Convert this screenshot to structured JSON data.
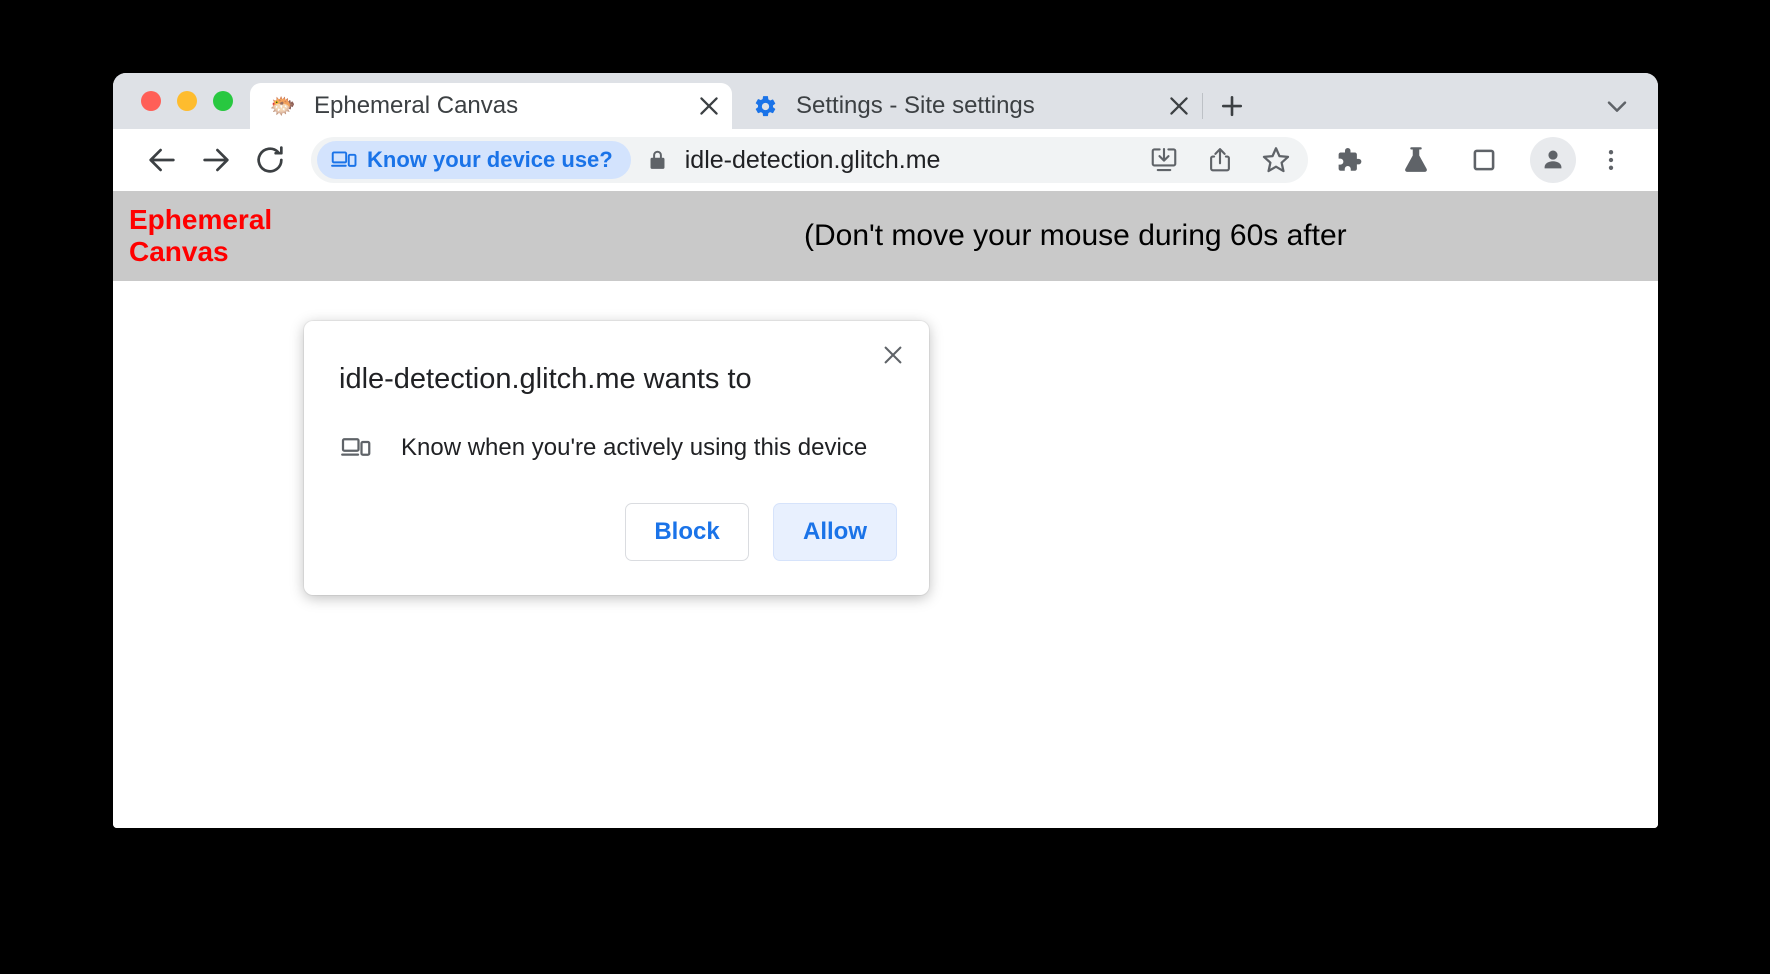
{
  "window": {
    "traffic_lights": [
      {
        "name": "close",
        "color": "#ff5f57"
      },
      {
        "name": "minimize",
        "color": "#febc2e"
      },
      {
        "name": "zoom",
        "color": "#28c840"
      }
    ]
  },
  "tabs": [
    {
      "title": "Ephemeral Canvas",
      "favicon": "pufferfish-favicon",
      "favicon_glyph": "🐡",
      "active": true,
      "close_label": "✕"
    },
    {
      "title": "Settings - Site settings",
      "favicon": "gear-favicon",
      "active": false,
      "close_label": "✕"
    }
  ],
  "tabstrip": {
    "new_tab_label": "+",
    "tab_search_label": "⌄"
  },
  "toolbar": {
    "back_label": "←",
    "forward_label": "→",
    "reload_label": "↻",
    "chip_label": "Know your device use?",
    "chip_icon": "device-idle-icon",
    "chip_color": "#1a73e8",
    "chip_background": "#d3e3fd",
    "lock_icon": "lock-icon",
    "url": "idle-detection.glitch.me",
    "omnibox_icons": [
      "install-desktop-icon",
      "share-icon",
      "bookmark-star-icon"
    ],
    "trailing_icons": [
      "extensions-puzzle-icon",
      "experiments-flask-icon",
      "side-panel-icon"
    ],
    "profile_icon": "profile-avatar-icon",
    "menu_icon": "three-dot-menu-icon"
  },
  "page": {
    "site_title": "Ephemeral Canvas",
    "site_title_color": "#ff0000",
    "instructions": "(Don't move your mouse during 60s after",
    "band_color": "#c9c9c9"
  },
  "permission_bubble": {
    "title": "idle-detection.glitch.me wants to",
    "close_label": "✕",
    "permission_icon": "device-idle-icon",
    "permission_label": "Know when you're actively using this device",
    "block_label": "Block",
    "allow_label": "Allow",
    "allow_background": "#e8f0fe",
    "accent_color": "#1a73e8"
  }
}
